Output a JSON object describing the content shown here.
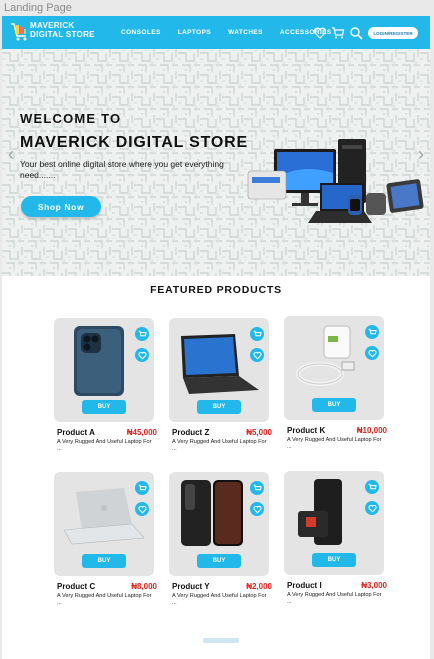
{
  "frame_label": "Landing Page",
  "brand": {
    "line1": "MAVERICK",
    "line2": "DIGITAL STORE"
  },
  "nav": {
    "items": [
      "CONSOLES",
      "LAPTOPS",
      "WATCHES",
      "ACCESSORIES"
    ],
    "login_label": "LOGIN/REGISTER"
  },
  "hero": {
    "welcome": "WELCOME TO",
    "title": "MAVERICK DIGITAL STORE",
    "subtitle": "Your best online digital store where you get everything need.......",
    "cta": "Shop Now",
    "prev": "‹",
    "next": "›"
  },
  "featured": {
    "title": "FEATURED PRODUCTS",
    "buy_label": "BUY",
    "products": [
      {
        "name": "Product A",
        "price": "₦45,000",
        "desc": "A Very Rugged And Useful Laptop For ...",
        "image": "phone"
      },
      {
        "name": "Product Z",
        "price": "₦5,000",
        "desc": "A Very Rugged And Useful Laptop For ...",
        "image": "laptop"
      },
      {
        "name": "Product K",
        "price": "₦10,000",
        "desc": "A Very Rugged And Useful Laptop For ...",
        "image": "charger"
      },
      {
        "name": "Product C",
        "price": "₦8,000",
        "desc": "A Very Rugged And Useful Laptop For ...",
        "image": "macbook"
      },
      {
        "name": "Product Y",
        "price": "₦2,000",
        "desc": "A Very Rugged And Useful Laptop For ...",
        "image": "phone-dark"
      },
      {
        "name": "Product I",
        "price": "₦3,000",
        "desc": "A Very Rugged And Useful Laptop For ...",
        "image": "powerbank"
      }
    ]
  },
  "colors": {
    "accent": "#22b9ea",
    "price": "#e0241b"
  }
}
